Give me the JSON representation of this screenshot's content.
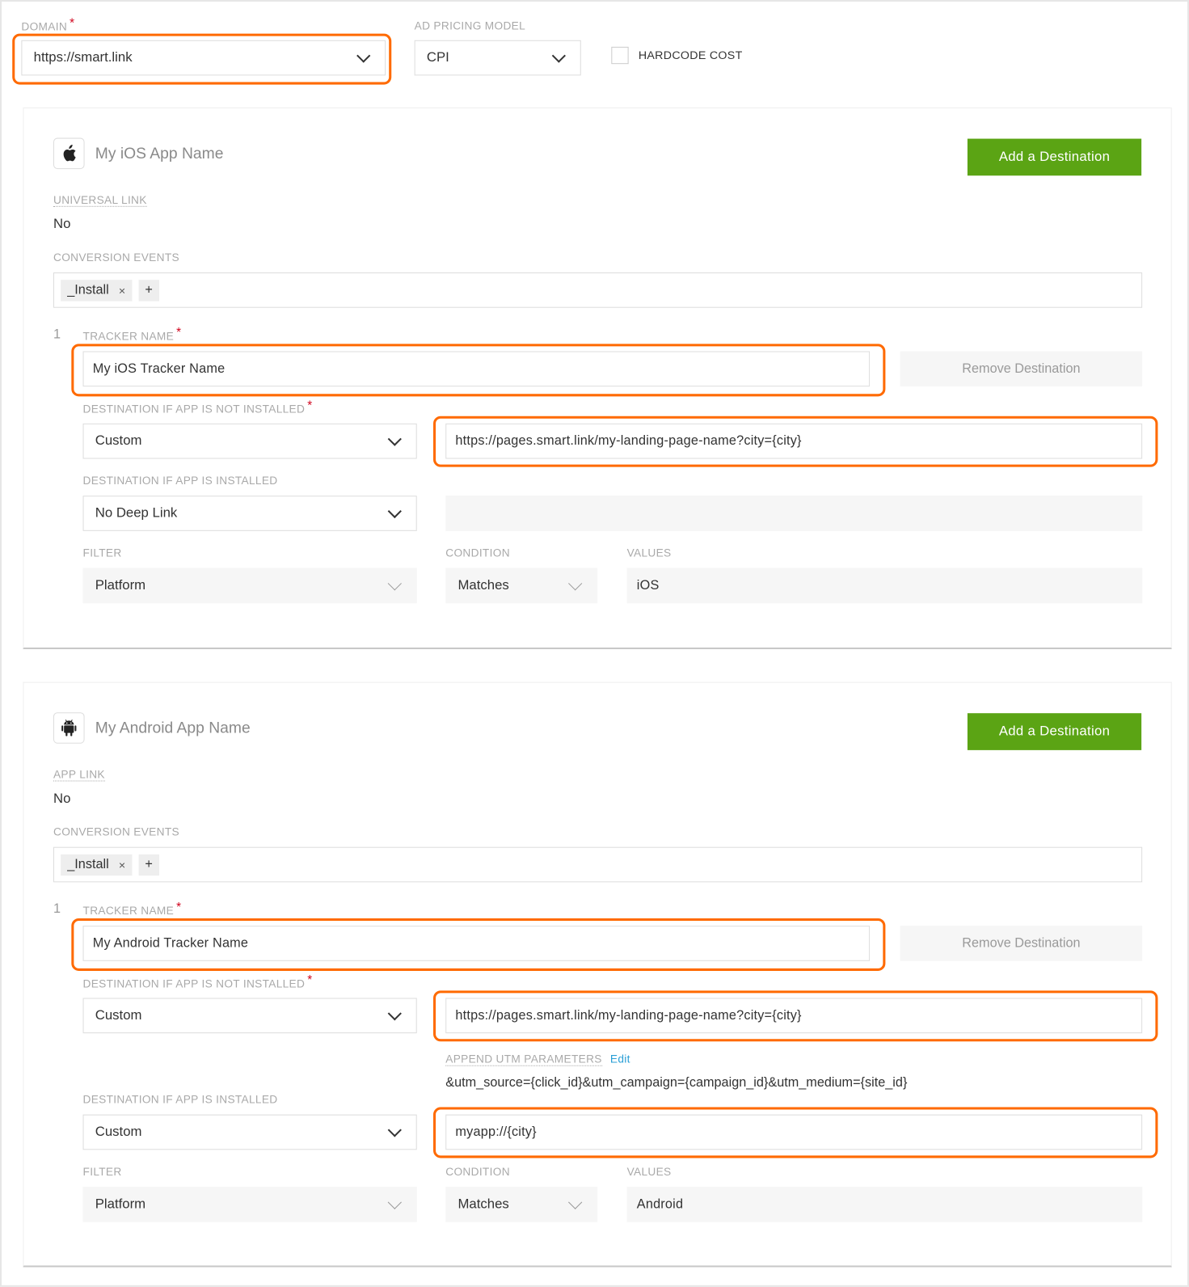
{
  "top": {
    "domain_label": "DOMAIN",
    "domain_value": "https://smart.link",
    "pricing_label": "AD PRICING MODEL",
    "pricing_value": "CPI",
    "hardcode_label": "HARDCODE COST",
    "hardcode_checked": false
  },
  "colors": {
    "highlight": "#ff6a00",
    "button": "#5ba414",
    "required": "#d0021b",
    "link": "#2a9fd6"
  },
  "ios": {
    "icon": "apple-icon",
    "app_name": "My iOS App Name",
    "add_button": "Add a Destination",
    "link_label": "UNIVERSAL LINK",
    "link_value": "No",
    "conversion_label": "CONVERSION EVENTS",
    "chip": "_Install",
    "chip_remove": "×",
    "chip_add": "+",
    "index": "1",
    "tracker_label": "TRACKER NAME",
    "tracker_value": "My iOS Tracker Name",
    "remove_button": "Remove Destination",
    "not_installed_label": "DESTINATION IF APP IS NOT INSTALLED",
    "not_installed_value": "Custom",
    "not_installed_url": "https://pages.smart.link/my-landing-page-name?city={city}",
    "installed_label": "DESTINATION IF APP IS INSTALLED",
    "installed_value": "No Deep Link",
    "filter_label": "FILTER",
    "filter_value": "Platform",
    "condition_label": "CONDITION",
    "condition_value": "Matches",
    "values_label": "VALUES",
    "values_value": "iOS"
  },
  "android": {
    "icon": "android-icon",
    "app_name": "My Android App Name",
    "add_button": "Add a Destination",
    "link_label": "APP LINK",
    "link_value": "No",
    "conversion_label": "CONVERSION EVENTS",
    "chip": "_Install",
    "chip_remove": "×",
    "chip_add": "+",
    "index": "1",
    "tracker_label": "TRACKER NAME",
    "tracker_value": "My Android Tracker Name",
    "remove_button": "Remove Destination",
    "not_installed_label": "DESTINATION IF APP IS NOT INSTALLED",
    "not_installed_value": "Custom",
    "not_installed_url": "https://pages.smart.link/my-landing-page-name?city={city}",
    "utm_label": "APPEND UTM PARAMETERS",
    "utm_edit": "Edit",
    "utm_value": "&utm_source={click_id}&utm_campaign={campaign_id}&utm_medium={site_id}",
    "installed_label": "DESTINATION IF APP IS INSTALLED",
    "installed_value": "Custom",
    "installed_url": "myapp://{city}",
    "filter_label": "FILTER",
    "filter_value": "Platform",
    "condition_label": "CONDITION",
    "condition_value": "Matches",
    "values_label": "VALUES",
    "values_value": "Android"
  }
}
